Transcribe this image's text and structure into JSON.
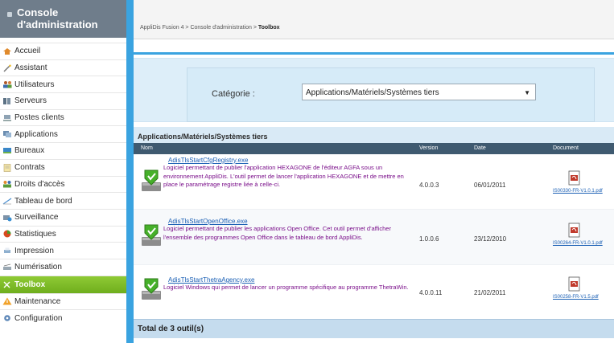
{
  "sidebar": {
    "title": "Console d'administration",
    "items": [
      {
        "label": "Accueil",
        "icon": "home-icon"
      },
      {
        "label": "Assistant",
        "icon": "wand-icon"
      },
      {
        "label": "Utilisateurs",
        "icon": "users-icon"
      },
      {
        "label": "Serveurs",
        "icon": "server-icon"
      },
      {
        "label": "Postes clients",
        "icon": "workstation-icon"
      },
      {
        "label": "Applications",
        "icon": "applications-icon"
      },
      {
        "label": "Bureaux",
        "icon": "desktop-icon"
      },
      {
        "label": "Contrats",
        "icon": "contract-icon"
      },
      {
        "label": "Droits d'accès",
        "icon": "access-rights-icon"
      },
      {
        "label": "Tableau de bord",
        "icon": "dashboard-icon"
      },
      {
        "label": "Surveillance",
        "icon": "monitoring-icon"
      },
      {
        "label": "Statistiques",
        "icon": "chart-icon"
      },
      {
        "label": "Impression",
        "icon": "printer-icon"
      },
      {
        "label": "Numérisation",
        "icon": "scanner-icon"
      },
      {
        "label": "Toolbox",
        "icon": "toolbox-icon",
        "active": true
      },
      {
        "label": "Maintenance",
        "icon": "warning-icon"
      },
      {
        "label": "Configuration",
        "icon": "gear-icon"
      }
    ]
  },
  "header": {
    "breadcrumb_prefix": "AppliDis Fusion 4 > Console d'administration > ",
    "breadcrumb_current": "Toolbox"
  },
  "filter": {
    "label": "Catégorie :",
    "selected": "Applications/Matériels/Systèmes tiers"
  },
  "results": {
    "title": "Applications/Matériels/Systèmes tiers",
    "columns": {
      "name": "Nom",
      "version": "Version",
      "date": "Date",
      "document": "Document"
    },
    "rows": [
      {
        "name": "AdisTlsStartCfgRegistry.exe",
        "description": "Logiciel permettant de publier l'application HEXAGONE de l'éditeur AGFA sous un environnement AppliDis. L'outil permet de lancer l'application HEXAGONE et de mettre en place le paramétrage registre liée à celle-ci.",
        "version": "4.0.0.3",
        "date": "06/01/2011",
        "document": "IS00330-FR-V1.0.1.pdf"
      },
      {
        "name": "AdisTlsStartOpenOffice.exe",
        "description": "Logiciel permettant de publier les applications Open Office. Cet outil permet d'afficher l'ensemble des programmes Open Office dans le tableau de bord AppliDis.",
        "version": "1.0.0.6",
        "date": "23/12/2010",
        "document": "IS00264-FR-V1.0.1.pdf"
      },
      {
        "name": "AdisTlsStartThetraAgency.exe",
        "description": "Logiciel Windows qui permet de lancer un programme spécifique au programme ThetraWin.",
        "version": "4.0.0.11",
        "date": "21/02/2011",
        "document": "IS00258-FR-V1.5.pdf"
      }
    ],
    "total": "Total de 3 outil(s)"
  }
}
